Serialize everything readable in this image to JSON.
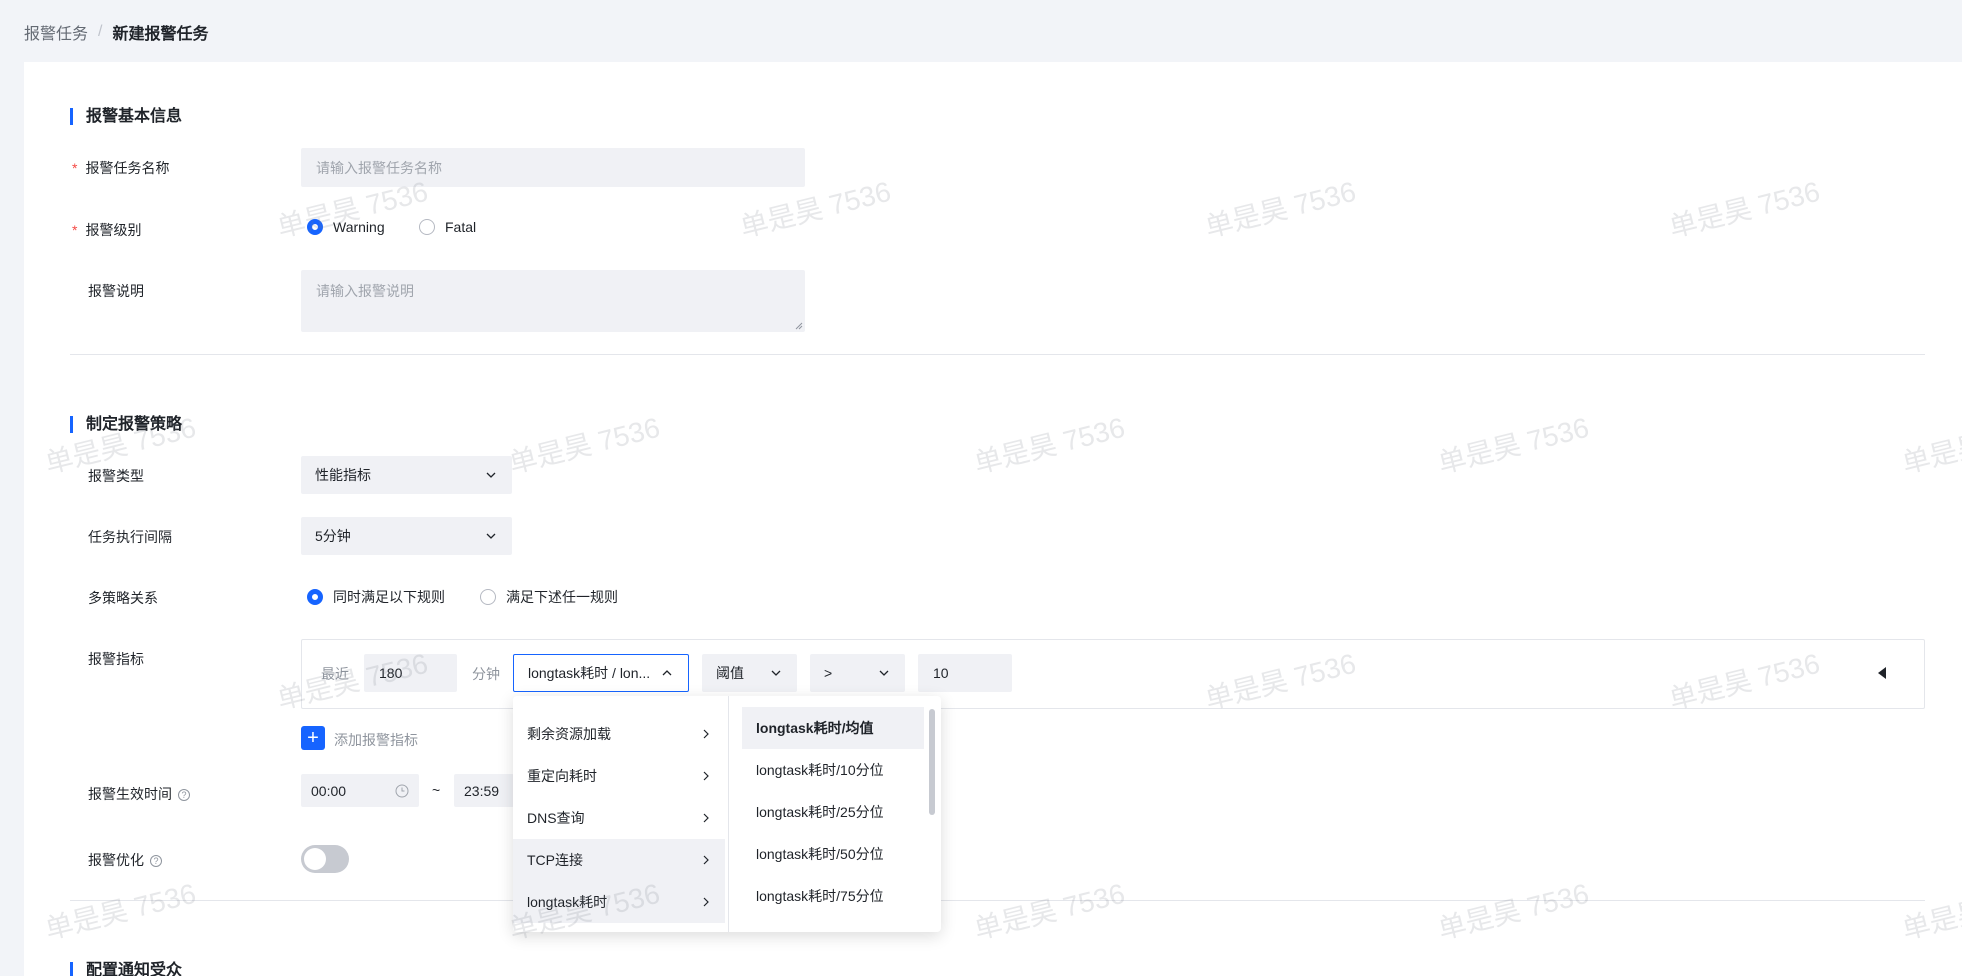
{
  "breadcrumb": {
    "parent": "报警任务",
    "separator": "/",
    "current": "新建报警任务"
  },
  "section_basic": {
    "title": "报警基本信息",
    "name_label": "报警任务名称",
    "name_placeholder": "请输入报警任务名称",
    "level_label": "报警级别",
    "level_options": [
      "Warning",
      "Fatal"
    ],
    "level_selected": "Warning",
    "desc_label": "报警说明",
    "desc_placeholder": "请输入报警说明"
  },
  "section_strategy": {
    "title": "制定报警策略",
    "type_label": "报警类型",
    "type_value": "性能指标",
    "interval_label": "任务执行间隔",
    "interval_value": "5分钟",
    "relation_label": "多策略关系",
    "relation_options": [
      "同时满足以下规则",
      "满足下述任一规则"
    ],
    "relation_selected": "同时满足以下规则",
    "metric_label": "报警指标",
    "metric_row": {
      "recent_label": "最近",
      "recent_value": "180",
      "unit_label": "分钟",
      "metric_value": "longtask耗时 / lon...",
      "threshold_value": "阈值",
      "operator_value": ">",
      "threshold_number": "10"
    },
    "add_metric_label": "添加报警指标",
    "effective_label": "报警生效时间",
    "time_start": "00:00",
    "time_sep": "~",
    "time_end": "23:59",
    "optimize_label": "报警优化",
    "optimize_enabled": false
  },
  "cascader": {
    "level1": [
      "剩余资源加载",
      "重定向耗时",
      "DNS查询",
      "TCP连接",
      "longtask耗时"
    ],
    "level1_selected": "longtask耗时",
    "level1_hover": "TCP连接",
    "level2": [
      "longtask耗时/均值",
      "longtask耗时/10分位",
      "longtask耗时/25分位",
      "longtask耗时/50分位",
      "longtask耗时/75分位"
    ],
    "level2_selected": "longtask耗时/均值"
  },
  "section_notify": {
    "title": "配置通知受众"
  },
  "watermark_text": "单是昊 7536",
  "colors": {
    "accent": "#1664ff",
    "required": "#f54a45",
    "field_bg": "#f0f1f5"
  }
}
